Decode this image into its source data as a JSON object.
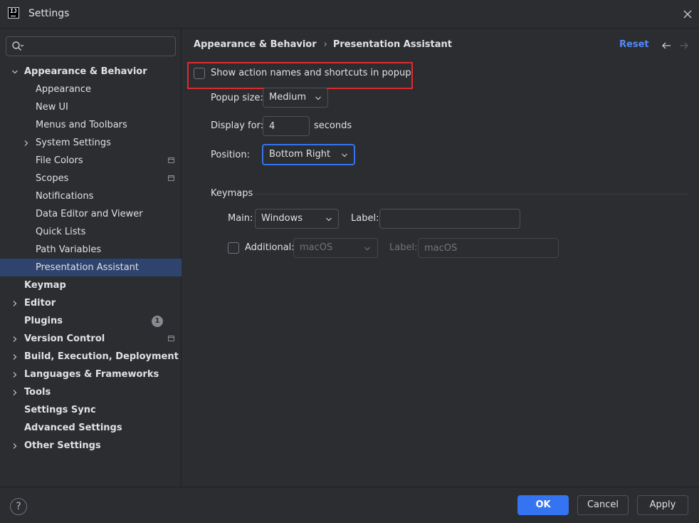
{
  "window": {
    "title": "Settings",
    "app_icon_text": "IJ"
  },
  "sidebar": {
    "search": {
      "value": "",
      "placeholder": ""
    },
    "items": [
      {
        "label": "Appearance & Behavior",
        "bold": true,
        "expanded": true,
        "level": 0
      },
      {
        "label": "Appearance",
        "level": 1
      },
      {
        "label": "New UI",
        "level": 1
      },
      {
        "label": "Menus and Toolbars",
        "level": 1
      },
      {
        "label": "System Settings",
        "level": 1,
        "expandable": true
      },
      {
        "label": "File Colors",
        "level": 1,
        "project_icon": true
      },
      {
        "label": "Scopes",
        "level": 1,
        "project_icon": true
      },
      {
        "label": "Notifications",
        "level": 1
      },
      {
        "label": "Data Editor and Viewer",
        "level": 1
      },
      {
        "label": "Quick Lists",
        "level": 1
      },
      {
        "label": "Path Variables",
        "level": 1
      },
      {
        "label": "Presentation Assistant",
        "level": 1,
        "selected": true
      },
      {
        "label": "Keymap",
        "bold": true,
        "level": 0
      },
      {
        "label": "Editor",
        "bold": true,
        "level": 0,
        "expandable": true
      },
      {
        "label": "Plugins",
        "bold": true,
        "level": 0,
        "badge": "1"
      },
      {
        "label": "Version Control",
        "bold": true,
        "level": 0,
        "expandable": true,
        "project_icon": true
      },
      {
        "label": "Build, Execution, Deployment",
        "bold": true,
        "level": 0,
        "expandable": true
      },
      {
        "label": "Languages & Frameworks",
        "bold": true,
        "level": 0,
        "expandable": true
      },
      {
        "label": "Tools",
        "bold": true,
        "level": 0,
        "expandable": true
      },
      {
        "label": "Settings Sync",
        "bold": true,
        "level": 0
      },
      {
        "label": "Advanced Settings",
        "bold": true,
        "level": 0
      },
      {
        "label": "Other Settings",
        "bold": true,
        "level": 0,
        "expandable": true
      }
    ]
  },
  "header": {
    "breadcrumb_parent": "Appearance & Behavior",
    "breadcrumb_separator": "›",
    "breadcrumb_current": "Presentation Assistant",
    "reset_label": "Reset"
  },
  "settings": {
    "show_action_names_label": "Show action names and shortcuts in popup",
    "show_action_names_checked": false,
    "popup_size_label": "Popup size:",
    "popup_size_value": "Medium",
    "display_for_label": "Display for:",
    "display_for_value": "4",
    "display_for_unit": "seconds",
    "position_label": "Position:",
    "position_value": "Bottom Right",
    "keymaps_section": "Keymaps",
    "main_label": "Main:",
    "main_keymap_value": "Windows",
    "main_keymap_label_label": "Label:",
    "main_keymap_label_value": "",
    "additional_label": "Additional:",
    "additional_checked": false,
    "additional_keymap_value": "macOS",
    "additional_keymap_label_label": "Label:",
    "additional_keymap_label_placeholder": "macOS"
  },
  "footer": {
    "help_label": "?",
    "ok_label": "OK",
    "cancel_label": "Cancel",
    "apply_label": "Apply"
  },
  "colors": {
    "background": "#2b2d30",
    "selection": "#2e436e",
    "accent": "#3574f0",
    "link": "#548af7",
    "highlight_box": "#e12a2f"
  }
}
